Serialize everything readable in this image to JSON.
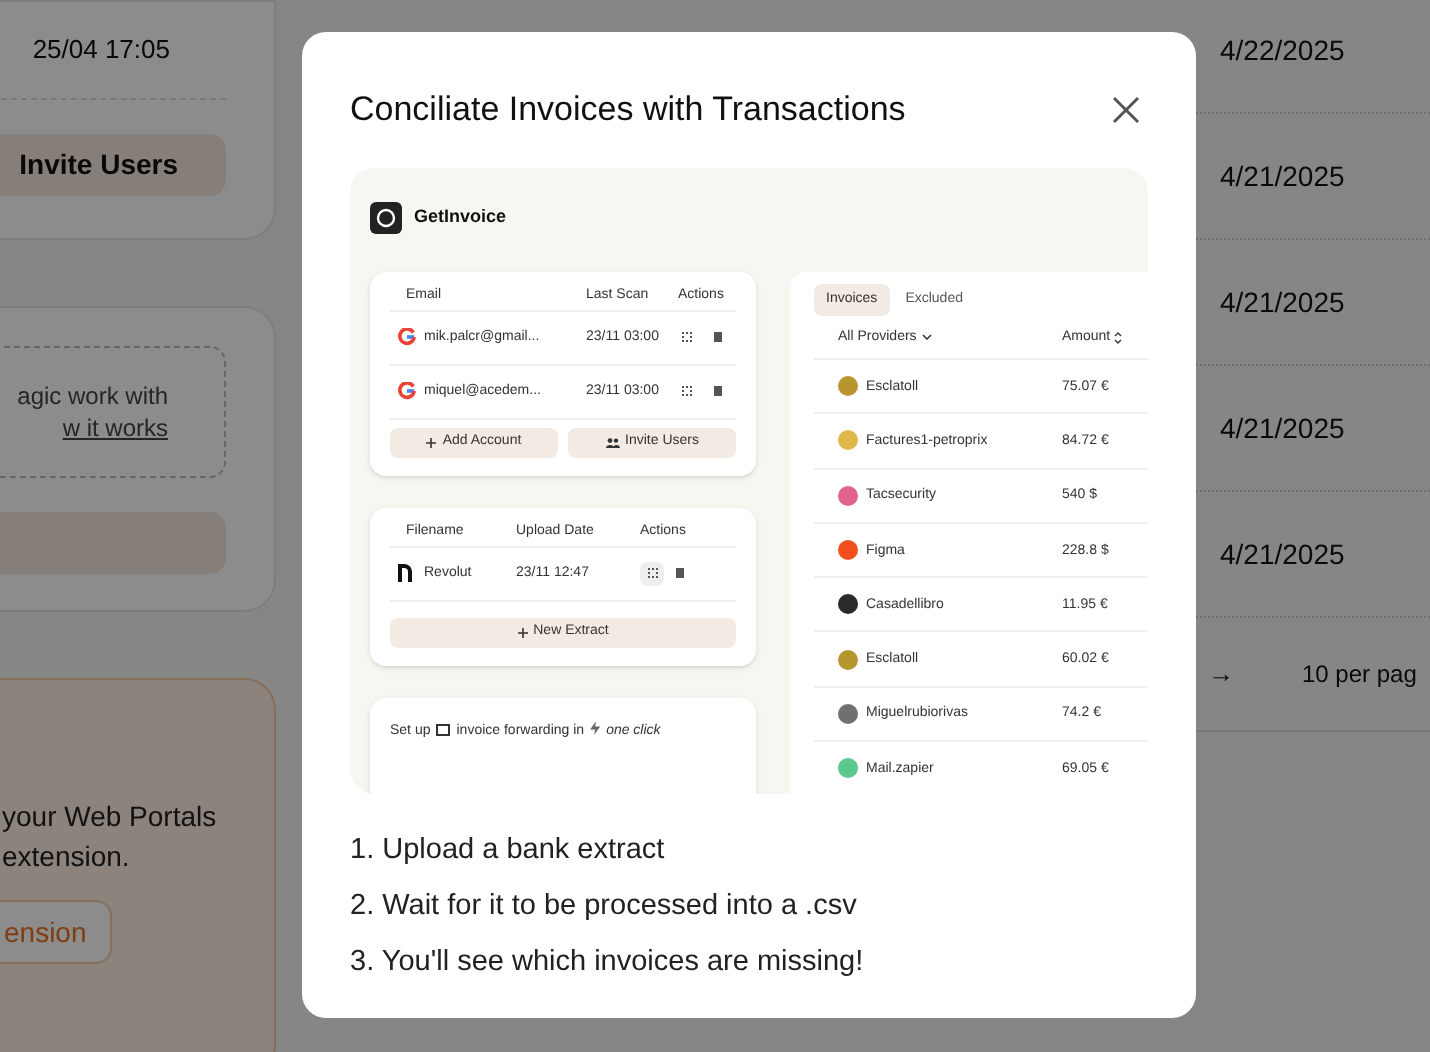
{
  "background": {
    "timestamp": "25/04 17:05",
    "invite_button": "Invite Users",
    "help_text": "agic work with",
    "help_link": "w it works",
    "extension_lines": [
      "your Web Portals",
      "extension."
    ],
    "extension_button": "ension",
    "table_dates": [
      "4/22/2025",
      "4/21/2025",
      "4/21/2025",
      "4/21/2025",
      "4/21/2025"
    ],
    "pagination": {
      "next": "→",
      "per_page": "10 per pag"
    }
  },
  "modal": {
    "title": "Conciliate Invoices with Transactions",
    "preview": {
      "app_name": "GetInvoice",
      "accounts": {
        "columns": [
          "Email",
          "Last Scan",
          "Actions"
        ],
        "rows": [
          {
            "email": "mik.palcr@gmail...",
            "last_scan": "23/11 03:00"
          },
          {
            "email": "miquel@acedem...",
            "last_scan": "23/11 03:00"
          }
        ],
        "buttons": [
          {
            "label": "Add Account",
            "kind": "add"
          },
          {
            "label": "Invite Users",
            "kind": "users"
          }
        ]
      },
      "extracts": {
        "columns": [
          "Filename",
          "Upload Date",
          "Actions"
        ],
        "rows": [
          {
            "filename": "Revolut",
            "upload_date": "23/11 12:47"
          }
        ],
        "button": "New Extract"
      },
      "forwarding": {
        "prefix": "Set up",
        "middle": "invoice forwarding in",
        "emphasis": "one click"
      },
      "invoices": {
        "tabs": [
          {
            "label": "Invoices",
            "selected": true
          },
          {
            "label": "Excluded",
            "selected": false
          }
        ],
        "filter": "All Providers",
        "amount_header": "Amount",
        "rows": [
          {
            "provider": "Esclatoll",
            "amount": "75.07 €",
            "color": "#b8962e"
          },
          {
            "provider": "Factures1-petroprix",
            "amount": "84.72 €",
            "color": "#e0b84a"
          },
          {
            "provider": "Tacsecurity",
            "amount": "540 $",
            "color": "#e2648a"
          },
          {
            "provider": "Figma",
            "amount": "228.8 $",
            "color": "#f24e1e"
          },
          {
            "provider": "Casadellibro",
            "amount": "11.95 €",
            "color": "#2a2a2a"
          },
          {
            "provider": "Esclatoll",
            "amount": "60.02 €",
            "color": "#b8962e"
          },
          {
            "provider": "Miguelrubiorivas",
            "amount": "74.2 €",
            "color": "#707070"
          },
          {
            "provider": "Mail.zapier",
            "amount": "69.05 €",
            "color": "#5cc98a"
          }
        ]
      }
    },
    "steps": [
      "1. Upload a bank extract",
      "2. Wait for it to be processed into a .csv",
      "3. You'll see which invoices are missing!"
    ]
  }
}
